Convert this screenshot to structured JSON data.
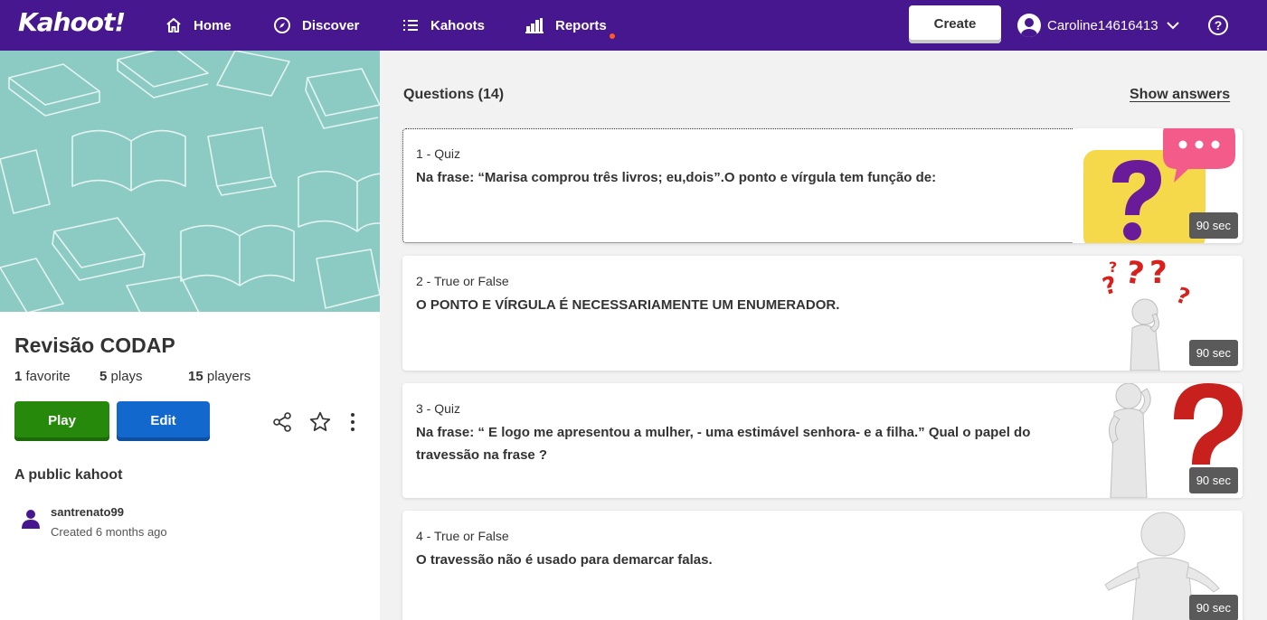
{
  "navbar": {
    "logo": "Kahoot!",
    "home_label": "Home",
    "discover_label": "Discover",
    "kahoots_label": "Kahoots",
    "reports_label": "Reports",
    "create_label": "Create",
    "username": "Caroline14616413",
    "help_label": "?"
  },
  "kahoot": {
    "title": "Revisão CODAP",
    "favorites_count": "1",
    "favorites_label": "favorite",
    "plays_count": "5",
    "plays_label": "plays",
    "players_count": "15",
    "players_label": "players",
    "play_label": "Play",
    "edit_label": "Edit",
    "visibility": "A public kahoot",
    "creator": "santrenato99",
    "created": "Created 6 months ago"
  },
  "questions": {
    "header": "Questions (14)",
    "show_answers": "Show answers",
    "items": [
      {
        "type": "1 - Quiz",
        "text": "Na frase: “Marisa comprou três livros; eu,dois”.O ponto e vírgula tem função de:",
        "time": "90 sec",
        "image_icon": "question-mark-speech-bubble-icon"
      },
      {
        "type": "2 - True or False",
        "text": "O PONTO E VÍRGULA É NECESSARIAMENTE UM ENUMERADOR.",
        "time": "90 sec",
        "image_icon": "thinking-figure-question-marks-icon"
      },
      {
        "type": "3 - Quiz",
        "text": "Na frase: “ E logo me apresentou a mulher, - uma estimável senhora- e a filha.” Qual o papel do travessão na frase ?",
        "time": "90 sec",
        "image_icon": "figure-big-question-mark-icon"
      },
      {
        "type": "4 - True or False",
        "text": "O travessão não é usado para demarcar falas.",
        "time": "90 sec",
        "image_icon": "shrugging-figure-icon"
      }
    ]
  },
  "colors": {
    "brand_purple": "#46178f",
    "play_green": "#26890c",
    "edit_blue": "#1368ce",
    "cover_teal": "#8ccbc3",
    "notification_orange": "#ff5a1f"
  }
}
